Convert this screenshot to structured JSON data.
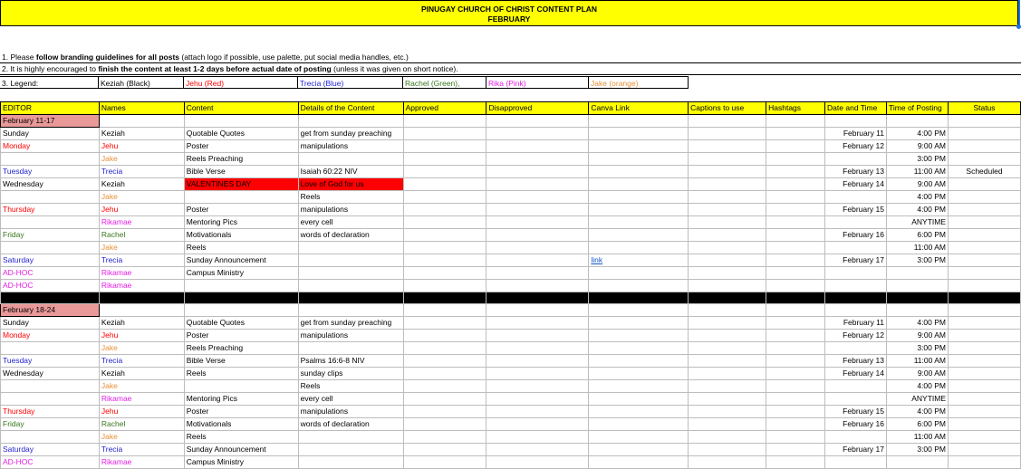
{
  "banner": {
    "line1": "PINUGAY CHURCH OF CHRIST CONTENT PLAN",
    "line2": "FEBRUARY"
  },
  "notes": {
    "n1_pre": "1. Please ",
    "n1_bold": "follow branding guidelines for all posts",
    "n1_post": " (attach logo if possible, use palette, put social media handles, etc.)",
    "n2_pre": "2. It is highly encouraged to ",
    "n2_bold": "finish the content at least 1-2 days before actual date of posting",
    "n2_post": " (unless it was given on short notice)."
  },
  "legend": {
    "label": "3. Legend:",
    "items": [
      "Keziah (Black)",
      "Jehu (Red)",
      "Trecia (Blue)",
      "Rachel (Green),",
      "Rika (Pink)",
      "Jake (orange)"
    ]
  },
  "colors": {
    "header_bg": "#ffff00",
    "week_bg": "#ea9999",
    "alert_bg": "#ff0000",
    "link": "#1155cc"
  },
  "headers": [
    "EDITOR",
    "Names",
    "Content",
    "Details of the Content",
    "Approved",
    "Disapproved",
    "Canva Link",
    "Captions to use",
    "Hashtags",
    "Date and Time",
    "Time of Posting",
    "Status"
  ],
  "week1": {
    "label": "February 11-17",
    "rows": [
      [
        "Sunday",
        "Keziah",
        "Quotable Quotes",
        "get from sunday preaching",
        "",
        "",
        "",
        "",
        "",
        "February 11",
        "4:00 PM",
        ""
      ],
      [
        "Monday",
        "Jehu",
        "Poster",
        "manipulations",
        "",
        "",
        "",
        "",
        "",
        "February 12",
        "9:00 AM",
        ""
      ],
      [
        "",
        "Jake",
        "Reels Preaching",
        "",
        "",
        "",
        "",
        "",
        "",
        "",
        "3:00 PM",
        ""
      ],
      [
        "Tuesday",
        "Trecia",
        "Bible Verse",
        "Isaiah 60:22 NIV",
        "",
        "",
        "",
        "",
        "",
        "February 13",
        "11:00 AM",
        "Scheduled"
      ],
      [
        "Wednesday",
        "Keziah",
        "VALENTINES DAY",
        "Love of God for us",
        "",
        "",
        "",
        "",
        "",
        "February 14",
        "9:00 AM",
        ""
      ],
      [
        "",
        "Jake",
        "",
        "Reels",
        "",
        "",
        "",
        "",
        "",
        "",
        "4:00 PM",
        ""
      ],
      [
        "Thursday",
        "Jehu",
        "Poster",
        "manipulations",
        "",
        "",
        "",
        "",
        "",
        "February 15",
        "4:00 PM",
        ""
      ],
      [
        "",
        "Rikamae",
        "Mentoring Pics",
        "every cell",
        "",
        "",
        "",
        "",
        "",
        "",
        "ANYTIME",
        ""
      ],
      [
        "Friday",
        "Rachel",
        "Motivationals",
        "words of declaration",
        "",
        "",
        "",
        "",
        "",
        "February 16",
        "6:00 PM",
        ""
      ],
      [
        "",
        "Jake",
        "Reels",
        "",
        "",
        "",
        "",
        "",
        "",
        "",
        "11:00 AM",
        ""
      ],
      [
        "Saturday",
        "Trecia",
        "Sunday Announcement",
        "",
        "",
        "",
        "link",
        "",
        "",
        "February 17",
        "3:00 PM",
        ""
      ],
      [
        "AD-HOC",
        "Rikamae",
        "Campus Ministry",
        "",
        "",
        "",
        "",
        "",
        "",
        "",
        "",
        ""
      ],
      [
        "AD-HOC",
        "Rikamae",
        "",
        "",
        "",
        "",
        "",
        "",
        "",
        "",
        "",
        ""
      ]
    ]
  },
  "week2": {
    "label": "February 18-24",
    "rows": [
      [
        "Sunday",
        "Keziah",
        "Quotable Quotes",
        "get from sunday preaching",
        "",
        "",
        "",
        "",
        "",
        "February 11",
        "4:00 PM",
        ""
      ],
      [
        "Monday",
        "Jehu",
        "Poster",
        "manipulations",
        "",
        "",
        "",
        "",
        "",
        "February 12",
        "9:00 AM",
        ""
      ],
      [
        "",
        "Jake",
        "Reels Preaching",
        "",
        "",
        "",
        "",
        "",
        "",
        "",
        "3:00 PM",
        ""
      ],
      [
        "Tuesday",
        "Trecia",
        "Bible Verse",
        "Psalms 16:6-8 NIV",
        "",
        "",
        "",
        "",
        "",
        "February 13",
        "11:00 AM",
        ""
      ],
      [
        "Wednesday",
        "Keziah",
        "Reels",
        "sunday clips",
        "",
        "",
        "",
        "",
        "",
        "February 14",
        "9:00 AM",
        ""
      ],
      [
        "",
        "Jake",
        "",
        "Reels",
        "",
        "",
        "",
        "",
        "",
        "",
        "4:00 PM",
        ""
      ],
      [
        "",
        "Rikamae",
        "Mentoring Pics",
        "every cell",
        "",
        "",
        "",
        "",
        "",
        "",
        "ANYTIME",
        ""
      ],
      [
        "Thursday",
        "Jehu",
        "Poster",
        "manipulations",
        "",
        "",
        "",
        "",
        "",
        "February 15",
        "4:00 PM",
        ""
      ],
      [
        "Friday",
        "Rachel",
        "Motivationals",
        "words of declaration",
        "",
        "",
        "",
        "",
        "",
        "February 16",
        "6:00 PM",
        ""
      ],
      [
        "",
        "Jake",
        "Reels",
        "",
        "",
        "",
        "",
        "",
        "",
        "",
        "11:00 AM",
        ""
      ],
      [
        "Saturday",
        "Trecia",
        "Sunday Announcement",
        "",
        "",
        "",
        "",
        "",
        "",
        "February 17",
        "3:00 PM",
        ""
      ],
      [
        "AD-HOC",
        "Rikamae",
        "Campus Ministry",
        "",
        "",
        "",
        "",
        "",
        "",
        "",
        "",
        ""
      ]
    ]
  }
}
